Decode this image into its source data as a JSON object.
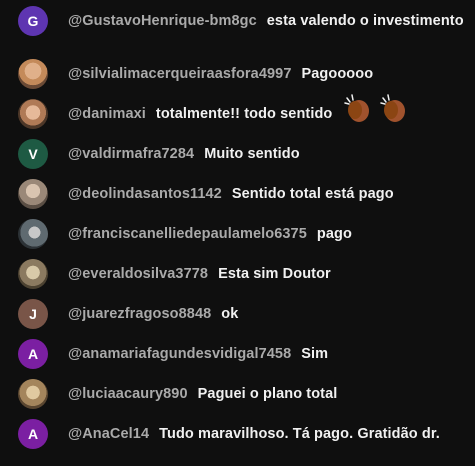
{
  "messages": [
    {
      "author": "@GustavoHenrique-bm8gc",
      "text": "esta valendo o investimento",
      "avatar": {
        "type": "letter",
        "letter": "G",
        "color": "#5e35b1"
      }
    },
    {
      "author": "@silvialimacerqueiraasfora4997",
      "text": "Pagooooo",
      "avatar": {
        "type": "photo",
        "color": "#c48a5a"
      }
    },
    {
      "author": "@danimaxi",
      "text": "totalmente!! todo sentido",
      "avatar": {
        "type": "photo",
        "color": "#b07a56"
      },
      "emoji": [
        "clapping-hands",
        "clapping-hands"
      ]
    },
    {
      "author": "@valdirmafra7284",
      "text": "Muito sentido",
      "avatar": {
        "type": "letter",
        "letter": "V",
        "color": "#1e5a43"
      }
    },
    {
      "author": "@deolindasantos1142",
      "text": "Sentido total está pago",
      "avatar": {
        "type": "photo",
        "color": "#9a8878"
      }
    },
    {
      "author": "@franciscanelliedepaulamelo6375",
      "text": "pago",
      "avatar": {
        "type": "photo",
        "color": "#5f6a70"
      }
    },
    {
      "author": "@everaldosilva3778",
      "text": "Esta sim Doutor",
      "avatar": {
        "type": "photo",
        "color": "#8b7a60"
      }
    },
    {
      "author": "@juarezfragoso8848",
      "text": "ok",
      "avatar": {
        "type": "letter",
        "letter": "J",
        "color": "#795548"
      }
    },
    {
      "author": "@anamariafagundesvidigal7458",
      "text": "Sim",
      "avatar": {
        "type": "letter",
        "letter": "A",
        "color": "#7b1fa2"
      }
    },
    {
      "author": "@luciaacaury890",
      "text": "Paguei o plano total",
      "avatar": {
        "type": "photo",
        "color": "#a4855c"
      }
    },
    {
      "author": "@AnaCel14",
      "text": "Tudo maravilhoso. Tá pago. Gratidão dr.",
      "avatar": {
        "type": "letter",
        "letter": "A",
        "color": "#7b1fa2"
      }
    }
  ]
}
